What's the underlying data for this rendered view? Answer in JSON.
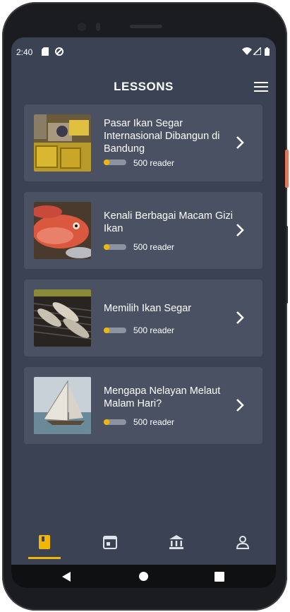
{
  "status": {
    "time": "2:40",
    "icons": [
      "sd-card-icon",
      "sync-icon",
      "wifi-icon",
      "signal-icon",
      "battery-icon"
    ]
  },
  "header": {
    "title": "LESSONS",
    "menu_icon": "hamburger-menu-icon"
  },
  "lessons": [
    {
      "title": "Pasar Ikan Segar Internasional Dibangun di Bandung",
      "readers": "500 reader",
      "progress": 0.25,
      "image": "fish-market-crates"
    },
    {
      "title": "Kenali Berbagai Macam Gizi Ikan",
      "readers": "500 reader",
      "progress": 0.25,
      "image": "red-snapper-fish"
    },
    {
      "title": "Memilih Ikan Segar",
      "readers": "500 reader",
      "progress": 0.25,
      "image": "grilled-fish"
    },
    {
      "title": "Mengapa Nelayan Melaut Malam Hari?",
      "readers": "500 reader",
      "progress": 0.25,
      "image": "sailing-boat"
    }
  ],
  "bottom_nav": {
    "items": [
      "book-icon",
      "calendar-icon",
      "bank-icon",
      "person-icon"
    ],
    "active": 0
  },
  "colors": {
    "background": "#3a4253",
    "card": "#4a5163",
    "accent": "#f2b705"
  }
}
